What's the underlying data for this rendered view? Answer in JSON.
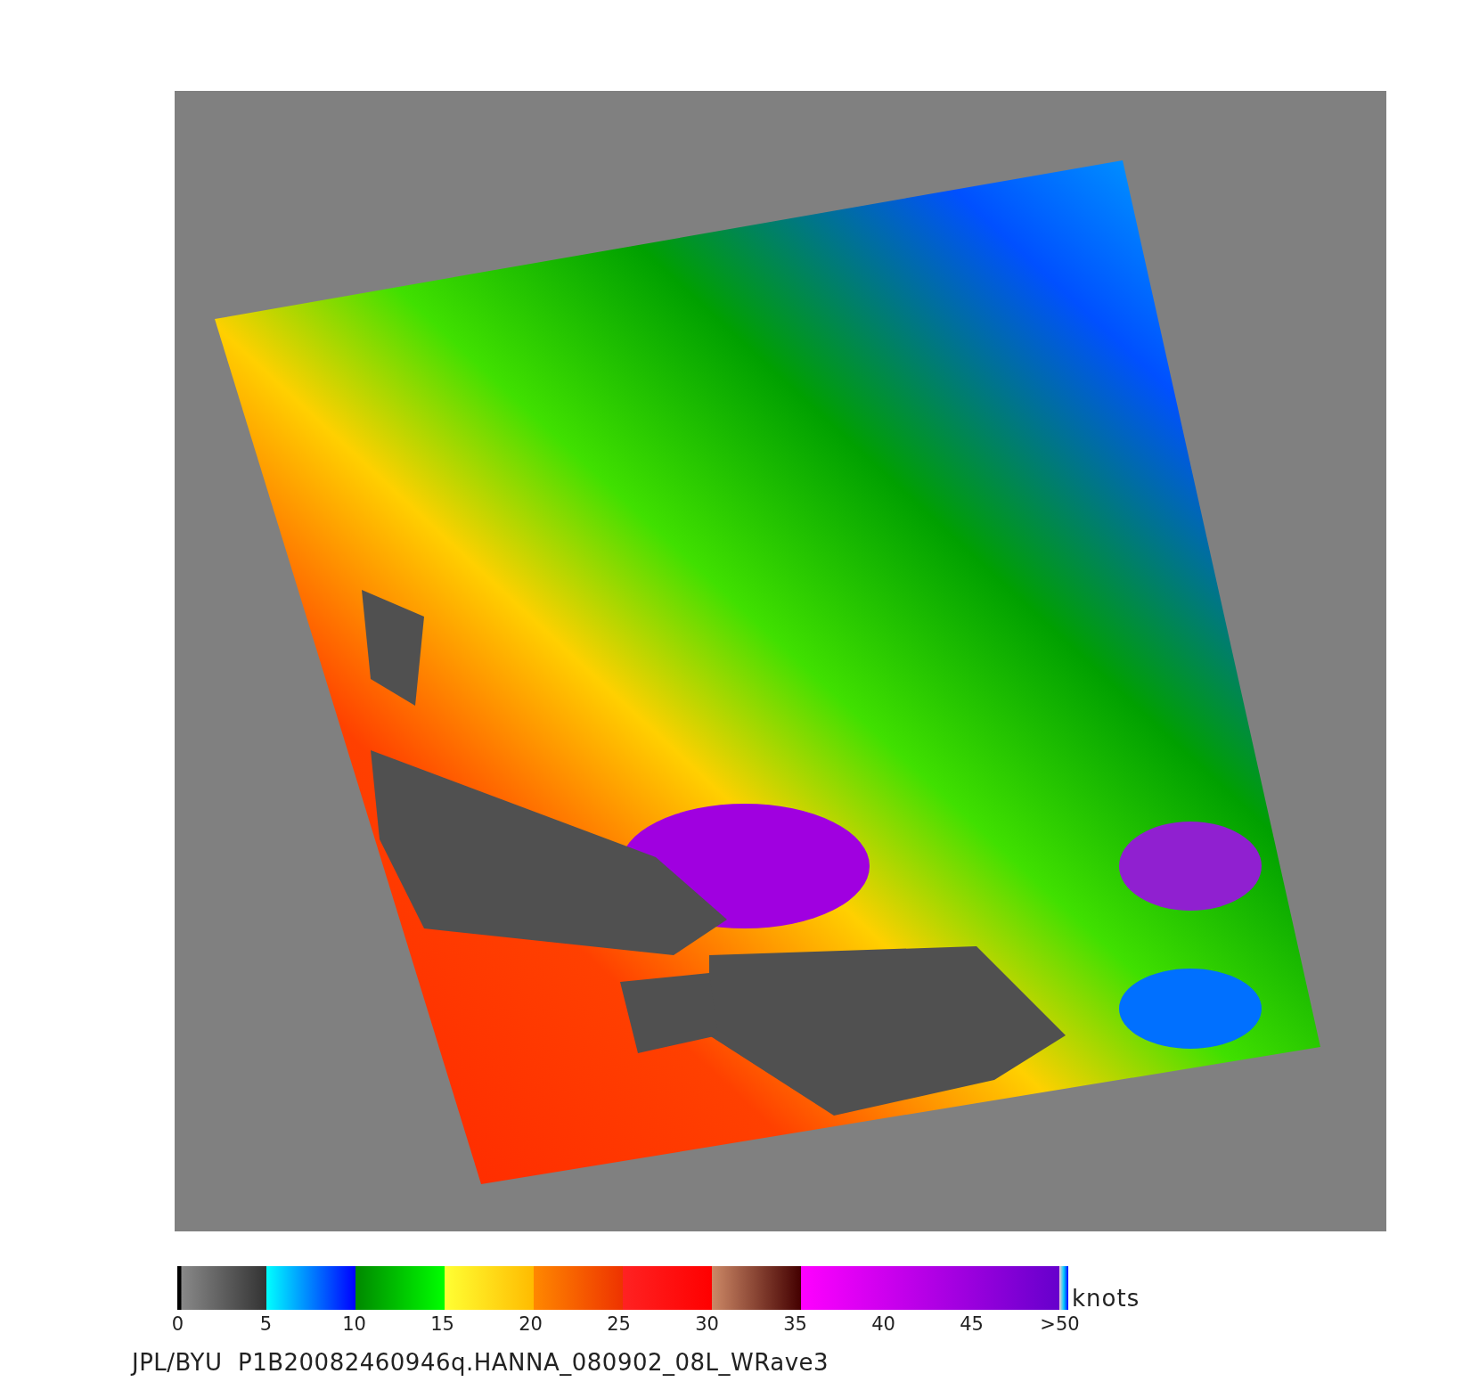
{
  "colorbar": {
    "unit": "knots",
    "ticks": [
      "0",
      "5",
      "10",
      "15",
      "20",
      "25",
      "30",
      "35",
      "40",
      "45",
      ">50"
    ]
  },
  "footer": {
    "caption": "JPL/BYU  P1B20082460946q.HANNA_080902_08L_WRave3"
  }
}
